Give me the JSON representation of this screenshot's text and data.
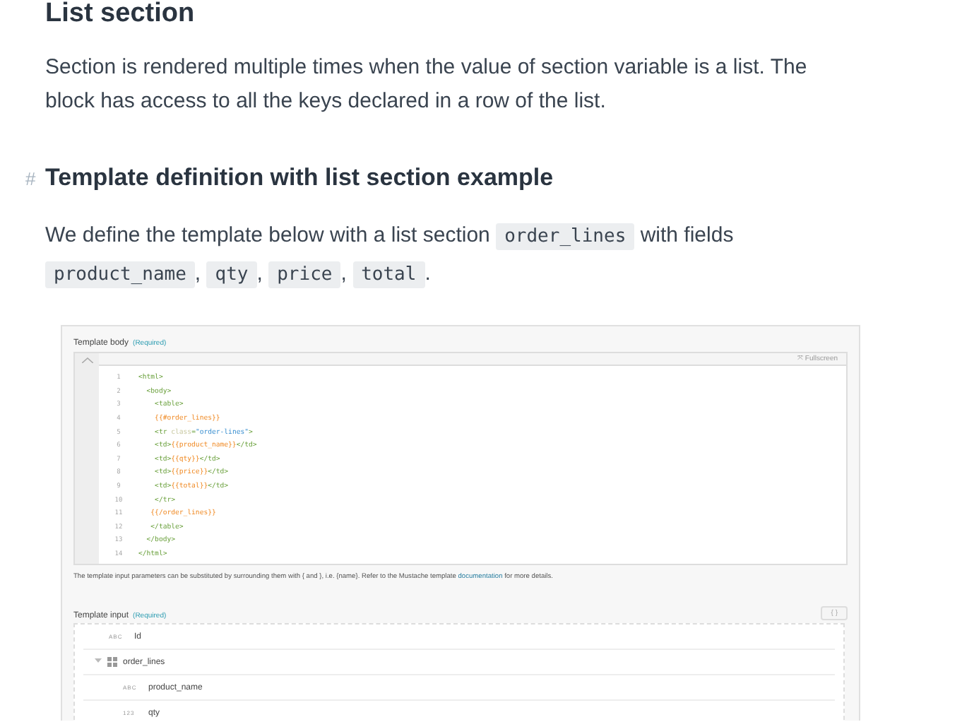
{
  "section_title": "List section",
  "intro": "Section is rendered multiple times when the value of section variable is a list. The block has access to all the keys declared in a row of the list.",
  "subsection": {
    "anchor": "#",
    "title": "Template definition with list section example"
  },
  "description": [
    {
      "kind": "text",
      "text": "We define the template below with a list section"
    },
    {
      "kind": "code",
      "text": "order_lines"
    },
    {
      "kind": "text",
      "text": "with fields"
    },
    {
      "kind": "code",
      "text": "product_name"
    },
    {
      "kind": "text",
      "text": ","
    },
    {
      "kind": "code",
      "text": "qty"
    },
    {
      "kind": "text",
      "text": ","
    },
    {
      "kind": "code",
      "text": "price"
    },
    {
      "kind": "text",
      "text": ","
    },
    {
      "kind": "code",
      "text": "total"
    },
    {
      "kind": "text",
      "text": "."
    }
  ],
  "embedded": {
    "body_label": "Template body",
    "body_required": "(Required)",
    "fullscreen": "⤧ Fullscreen",
    "lines": [
      {
        "number": "1",
        "segments": [
          {
            "kind": "tag",
            "text": "<html>"
          }
        ]
      },
      {
        "number": "2",
        "segments": [
          {
            "kind": "tag",
            "text": "  <body>"
          }
        ]
      },
      {
        "number": "3",
        "segments": [
          {
            "kind": "tag",
            "text": "    <table>"
          }
        ]
      },
      {
        "number": "4",
        "segments": [
          {
            "kind": "mustache",
            "text": "    {{#order_lines}}"
          }
        ]
      },
      {
        "number": "5",
        "segments": [
          {
            "kind": "tag",
            "text": "    <tr "
          },
          {
            "kind": "attr",
            "text": "class"
          },
          {
            "kind": "tag",
            "text": "="
          },
          {
            "kind": "string",
            "text": "\"order-lines\""
          },
          {
            "kind": "tag",
            "text": ">"
          }
        ]
      },
      {
        "number": "6",
        "segments": [
          {
            "kind": "tag",
            "text": "    <td>"
          },
          {
            "kind": "mustache",
            "text": "{{product_name}}"
          },
          {
            "kind": "tag",
            "text": "</td>"
          }
        ]
      },
      {
        "number": "7",
        "segments": [
          {
            "kind": "tag",
            "text": "    <td>"
          },
          {
            "kind": "mustache",
            "text": "{{qty}}"
          },
          {
            "kind": "tag",
            "text": "</td>"
          }
        ]
      },
      {
        "number": "8",
        "segments": [
          {
            "kind": "tag",
            "text": "    <td>"
          },
          {
            "kind": "mustache",
            "text": "{{price}}"
          },
          {
            "kind": "tag",
            "text": "</td>"
          }
        ]
      },
      {
        "number": "9",
        "segments": [
          {
            "kind": "tag",
            "text": "    <td>"
          },
          {
            "kind": "mustache",
            "text": "{{total}}"
          },
          {
            "kind": "tag",
            "text": "</td>"
          }
        ]
      },
      {
        "number": "10",
        "segments": [
          {
            "kind": "tag",
            "text": "    </tr>"
          }
        ]
      },
      {
        "number": "11",
        "segments": [
          {
            "kind": "mustache",
            "text": "   {{/order_lines}}"
          }
        ]
      },
      {
        "number": "12",
        "segments": [
          {
            "kind": "tag",
            "text": "   </table>"
          }
        ]
      },
      {
        "number": "13",
        "segments": [
          {
            "kind": "tag",
            "text": "  </body>"
          }
        ]
      },
      {
        "number": "14",
        "segments": [
          {
            "kind": "tag",
            "text": "</html>"
          }
        ]
      }
    ],
    "help_text": "The template input parameters can be substituted by surrounding them with { and }, i.e. {name}. Refer to the Mustache template",
    "help_link": "documentation",
    "help_tail": "for more details.",
    "input_label": "Template input",
    "input_required": "(Required)",
    "json_button": "{ }",
    "fields": [
      {
        "type": "ABC",
        "name": "Id",
        "kind": "field"
      },
      {
        "name": "order_lines",
        "kind": "list",
        "expanded": true,
        "children": [
          {
            "type": "ABC",
            "name": "product_name",
            "kind": "field"
          },
          {
            "type": "123",
            "name": "qty",
            "kind": "field"
          }
        ]
      }
    ]
  }
}
